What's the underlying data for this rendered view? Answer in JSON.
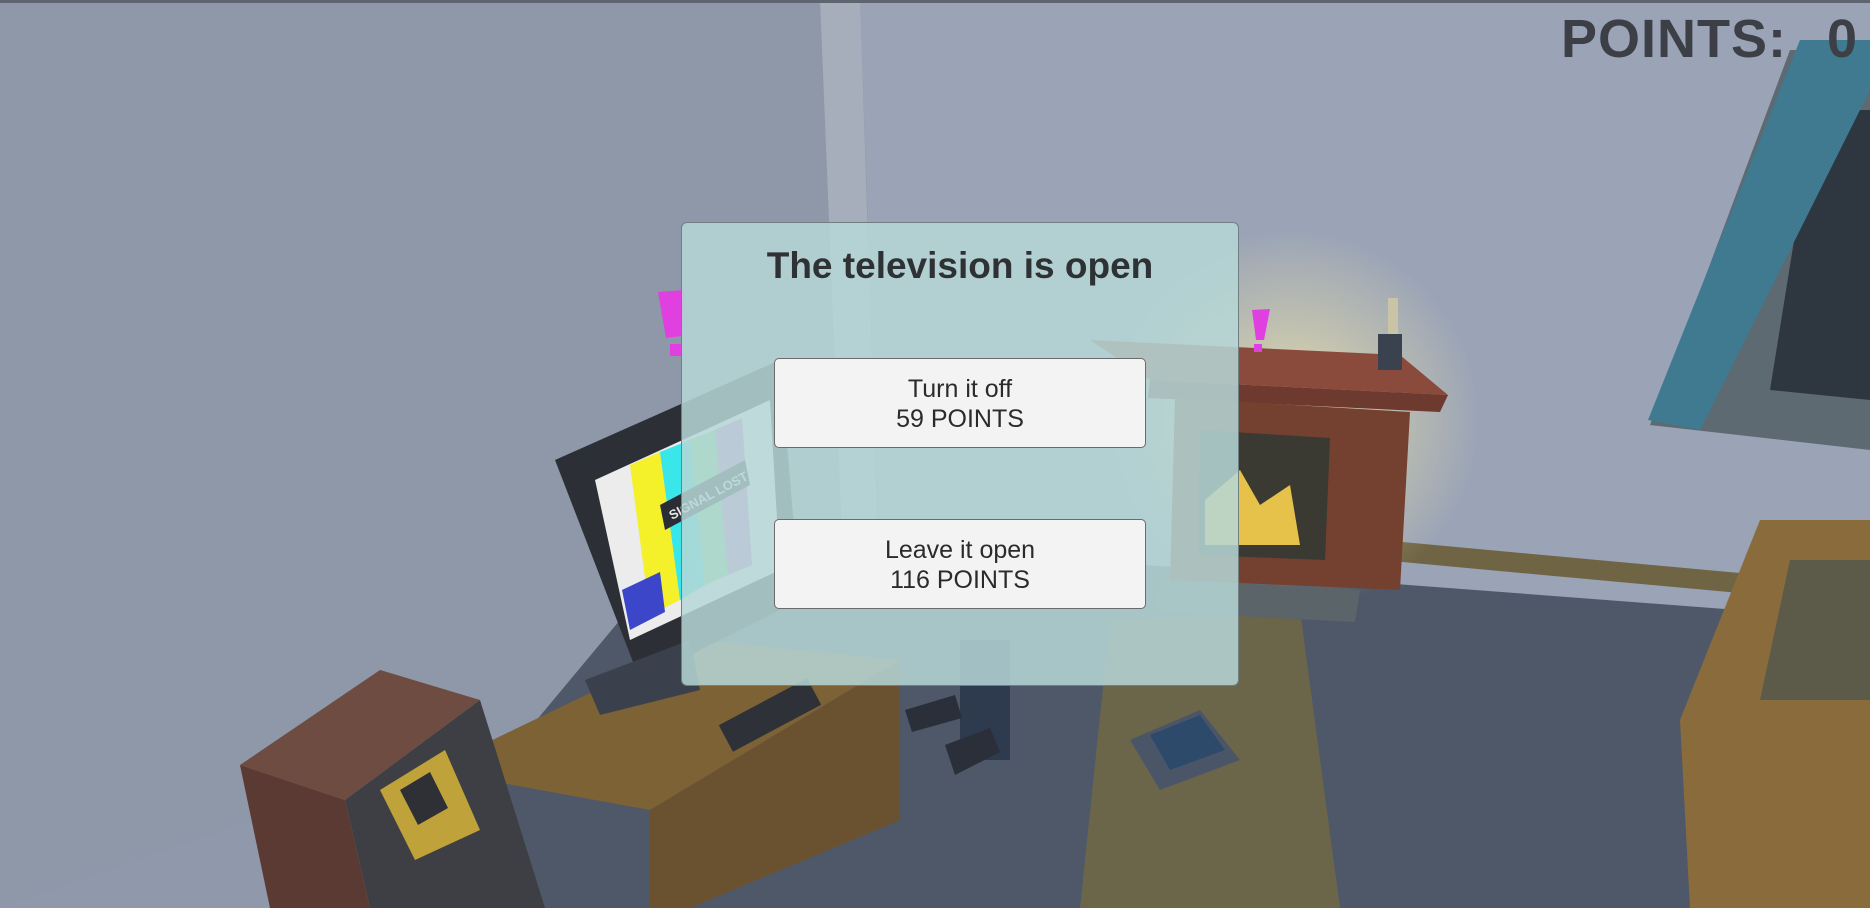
{
  "hud": {
    "points_label": "POINTS:",
    "points_value": "0"
  },
  "dialog": {
    "title": "The television is open",
    "choices": [
      {
        "action": "Turn it off",
        "points": "59 POINTS"
      },
      {
        "action": "Leave it open",
        "points": "116 POINTS"
      }
    ]
  },
  "scene": {
    "tv_screen_text": "SIGNAL LOST"
  },
  "colors": {
    "alert_marker": "#e040e0",
    "dialog_background": "#b6d6d6",
    "hud_text": "#3c3f45"
  }
}
